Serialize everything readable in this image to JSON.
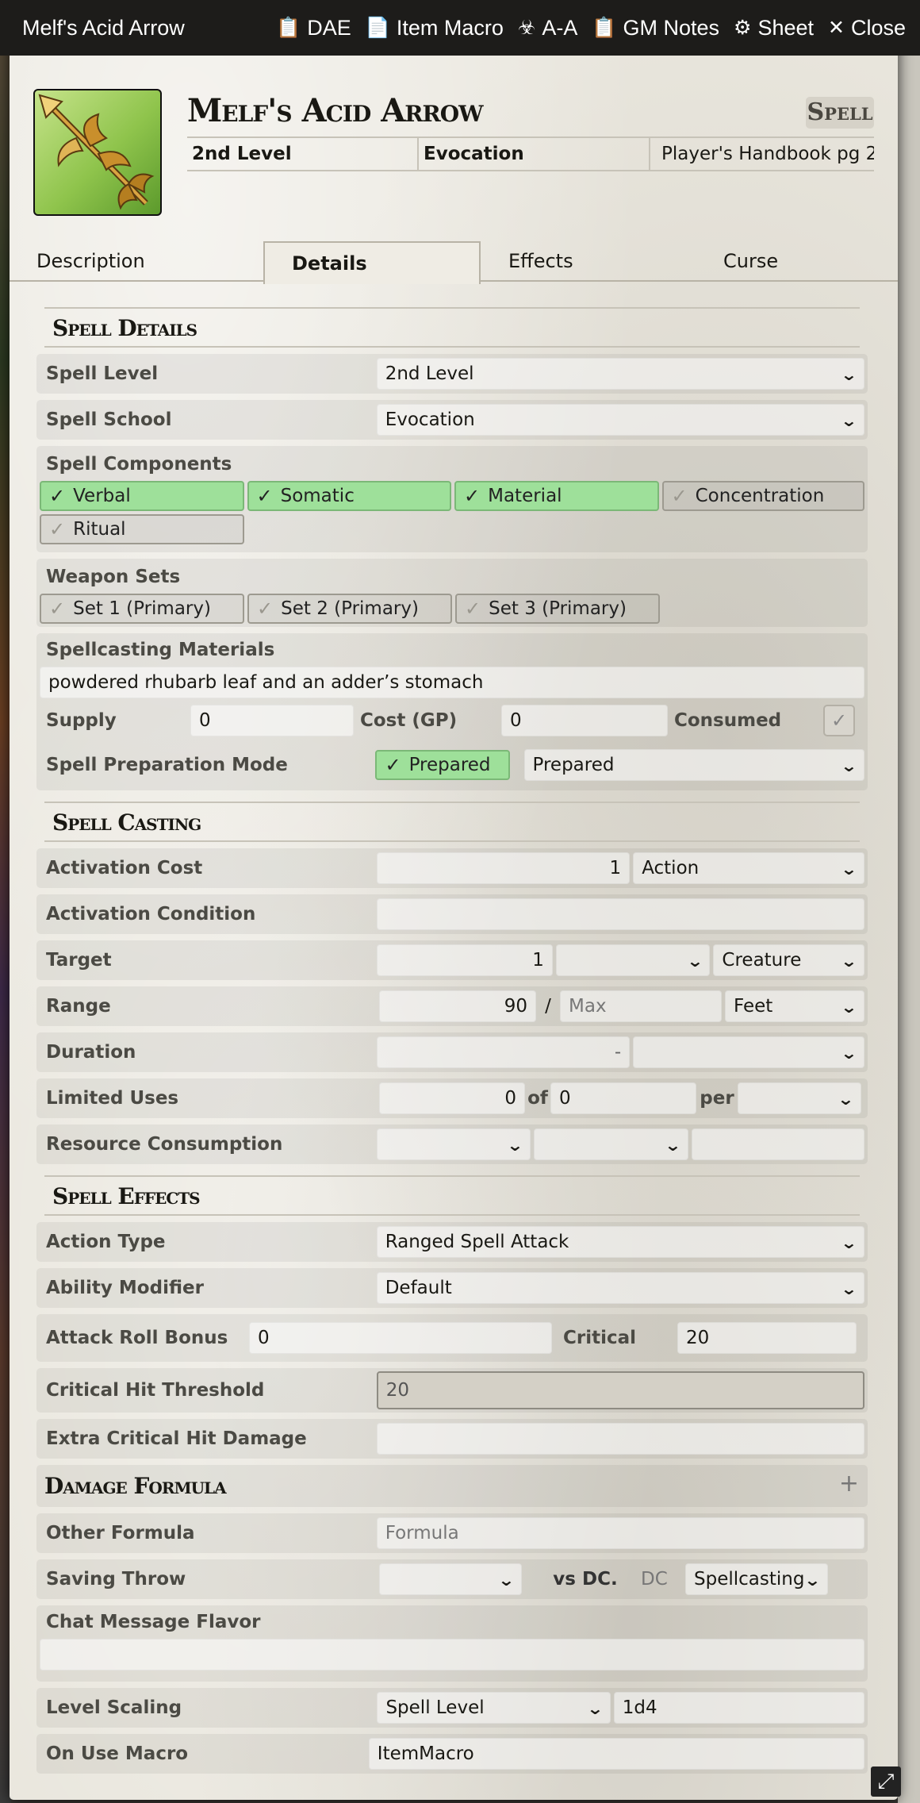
{
  "window": {
    "title": "Melf's Acid Arrow",
    "buttons": [
      {
        "icon": "clipboard-icon",
        "label": "DAE"
      },
      {
        "icon": "document-icon",
        "label": "Item Macro"
      },
      {
        "icon": "biohazard-icon",
        "label": "A-A"
      },
      {
        "icon": "clipboard-icon",
        "label": "GM Notes"
      },
      {
        "icon": "gear-icon",
        "label": "Sheet"
      },
      {
        "icon": "close-icon",
        "label": "Close"
      }
    ]
  },
  "header": {
    "name": "Melf's Acid Arrow",
    "type": "Spell",
    "level": "2nd Level",
    "school": "Evocation",
    "source": "Player's Handbook pg 2"
  },
  "tabs": [
    "Description",
    "Details",
    "Effects",
    "Curse"
  ],
  "active_tab": "Details",
  "spell_details": {
    "title": "Spell Details",
    "spell_level_label": "Spell Level",
    "spell_level_value": "2nd Level",
    "spell_school_label": "Spell School",
    "spell_school_value": "Evocation",
    "components_label": "Spell Components",
    "components": [
      {
        "label": "Verbal",
        "checked": true
      },
      {
        "label": "Somatic",
        "checked": true
      },
      {
        "label": "Material",
        "checked": true
      },
      {
        "label": "Concentration",
        "checked": false
      },
      {
        "label": "Ritual",
        "checked": false
      }
    ],
    "weapon_sets_label": "Weapon Sets",
    "weapon_sets": [
      "Set 1 (Primary)",
      "Set 2 (Primary)",
      "Set 3 (Primary)"
    ],
    "materials_label": "Spellcasting Materials",
    "materials_value": "powdered rhubarb leaf and an adder’s stomach",
    "supply_label": "Supply",
    "supply_value": "0",
    "cost_label": "Cost (GP)",
    "cost_value": "0",
    "consumed_label": "Consumed",
    "prep_label": "Spell Preparation Mode",
    "prep_toggle": "Prepared",
    "prep_mode": "Prepared"
  },
  "spell_casting": {
    "title": "Spell Casting",
    "activation_cost_label": "Activation Cost",
    "activation_cost_value": "1",
    "activation_cost_type": "Action",
    "activation_condition_label": "Activation Condition",
    "target_label": "Target",
    "target_value": "1",
    "target_unit": "",
    "target_type": "Creature",
    "range_label": "Range",
    "range_value": "90",
    "range_sep": "/",
    "range_max_placeholder": "Max",
    "range_unit": "Feet",
    "duration_label": "Duration",
    "duration_value": "-",
    "limited_uses_label": "Limited Uses",
    "limited_uses_value": "0",
    "of_label": "of",
    "limited_uses_max": "0",
    "per_label": "per",
    "resource_label": "Resource Consumption"
  },
  "spell_effects": {
    "title": "Spell Effects",
    "action_type_label": "Action Type",
    "action_type_value": "Ranged Spell Attack",
    "ability_modifier_label": "Ability Modifier",
    "ability_modifier_value": "Default",
    "attack_bonus_label": "Attack Roll Bonus",
    "attack_bonus_value": "0",
    "critical_label": "Critical",
    "critical_value": "20",
    "crit_threshold_label": "Critical Hit Threshold",
    "crit_threshold_value": "20",
    "extra_crit_label": "Extra Critical Hit Damage"
  },
  "damage": {
    "title": "Damage Formula",
    "add_icon": "plus-icon",
    "other_formula_label": "Other Formula",
    "other_formula_placeholder": "Formula",
    "saving_throw_label": "Saving Throw",
    "vs_dc_label": "vs DC.",
    "dc_placeholder": "DC",
    "dc_source": "Spellcasting",
    "chat_flavor_label": "Chat Message Flavor",
    "level_scaling_label": "Level Scaling",
    "level_scaling_value": "Spell Level",
    "level_scaling_formula": "1d4",
    "on_use_macro_label": "On Use Macro",
    "on_use_macro_value": "ItemMacro"
  },
  "colors": {
    "checked_green": "#9ee09a",
    "titlebar": "#1d1c1a",
    "sheet_bg": "#e9e6dd"
  }
}
